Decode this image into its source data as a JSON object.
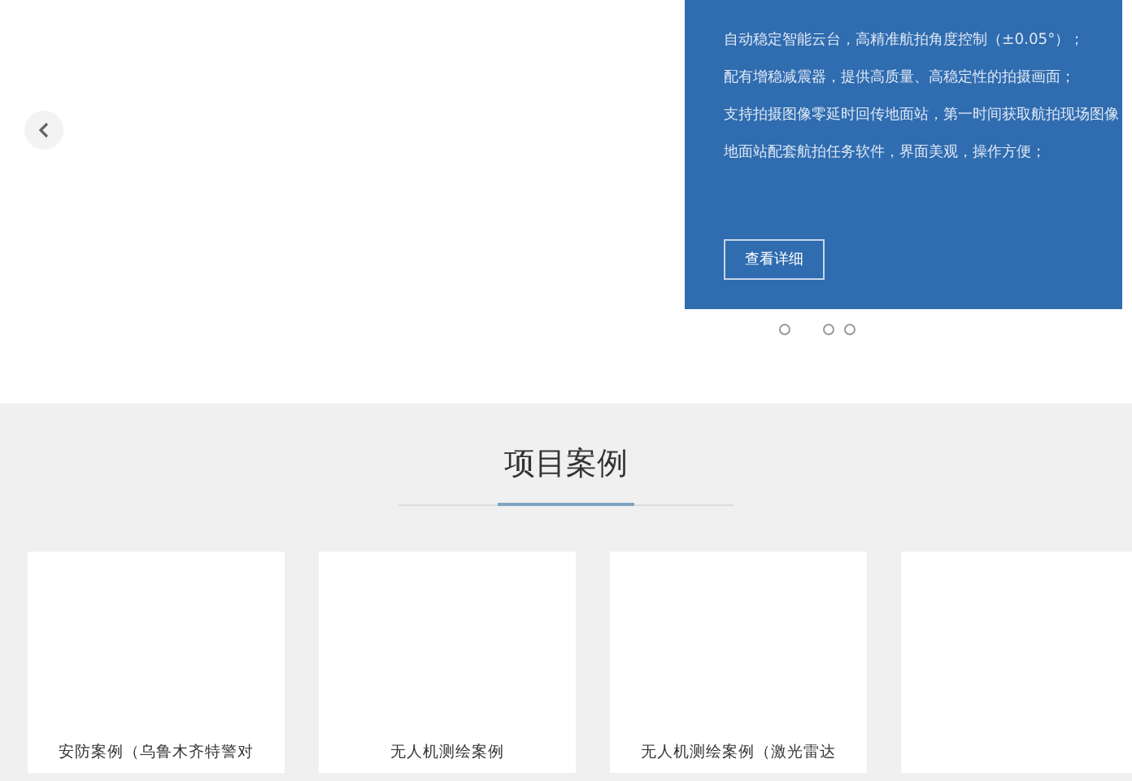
{
  "slider": {
    "features": [
      "自动稳定智能云台，高精准航拍角度控制（±0.05°）；",
      "配有增稳减震器，提供高质量、高稳定性的拍摄画面；",
      "支持拍摄图像零延时回传地面站，第一时间获取航拍现场图像",
      "地面站配套航拍任务软件，界面美观，操作方便；"
    ],
    "button": "查看详细",
    "dots": [
      {
        "selected": false
      },
      {
        "selected": false
      },
      {
        "selected": false
      }
    ]
  },
  "cases": {
    "title": "项目案例",
    "items": [
      {
        "kind": "captioned",
        "caption": "安防案例（乌鲁木齐特警对"
      },
      {
        "kind": "captioned",
        "caption": "无人机测绘案例"
      },
      {
        "kind": "captioned",
        "caption": "无人机测绘案例（激光雷达"
      },
      {
        "kind": "blank"
      }
    ]
  }
}
